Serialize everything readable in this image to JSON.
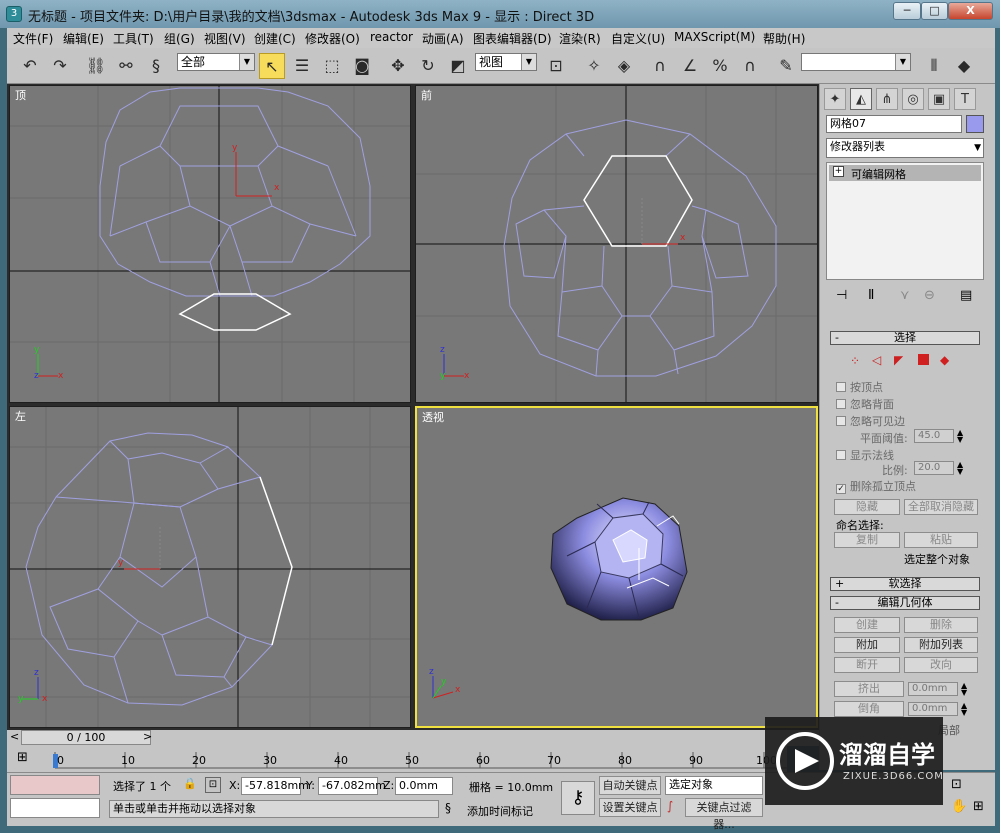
{
  "window": {
    "title": "无标题      - 项目文件夹: D:\\用户目录\\我的文档\\3dsmax      - Autodesk 3ds Max 9      - 显示 : Direct 3D",
    "min_glyph": "─",
    "max_glyph": "□",
    "close_glyph": "X"
  },
  "menu": [
    "文件(F)",
    "编辑(E)",
    "工具(T)",
    "组(G)",
    "视图(V)",
    "创建(C)",
    "修改器(O)",
    "reactor",
    "动画(A)",
    "图表编辑器(D)",
    "渲染(R)",
    "自定义(U)",
    "MAXScript(M)",
    "帮助(H)"
  ],
  "toolbar": {
    "selection_filter": "全部",
    "ref_coord": "视图",
    "named_selection": ""
  },
  "viewports": {
    "top": "顶",
    "front": "前",
    "left": "左",
    "perspective": "透视"
  },
  "command_panel": {
    "object_name": "网格07",
    "object_color": "#9999ee",
    "modifier_list": "修改器列表",
    "stack_item": "可编辑网格",
    "selection_rollout": {
      "title": "选择",
      "by_vertex": "按顶点",
      "ignore_backfacing": "忽略背面",
      "ignore_visible_edges": "忽略可见边",
      "planar_threshold_label": "平面阈值:",
      "planar_threshold": "45.0",
      "show_normals": "显示法线",
      "scale_label": "比例:",
      "scale": "20.0",
      "delete_isolated": "删除孤立顶点",
      "hide": "隐藏",
      "unhide_all": "全部取消隐藏",
      "named_sel": "命名选择:",
      "copy": "复制",
      "paste": "粘贴",
      "select_whole": "选定整个对象"
    },
    "soft_selection": "软选择",
    "edit_geometry": {
      "title": "编辑几何体",
      "create": "创建",
      "delete": "删除",
      "attach": "附加",
      "attach_list": "附加列表",
      "break": "断开",
      "turn": "改向",
      "extrude": "挤出",
      "extrude_val": "0.0mm",
      "chamfer": "倒角",
      "chamfer_val": "0.0mm",
      "partial": "局部"
    }
  },
  "timeline": {
    "frame": "0 / 100",
    "ticks": [
      "0",
      "10",
      "20",
      "30",
      "40",
      "50",
      "60",
      "70",
      "80",
      "90",
      "100"
    ]
  },
  "status": {
    "selected": "选择了 1 个",
    "x_label": "X:",
    "x_value": "-57.818mm",
    "y_label": "Y:",
    "y_value": "-67.082mm",
    "z_label": "Z:",
    "z_value": "0.0mm",
    "grid": "栅格 = 10.0mm",
    "prompt": "单击或单击并拖动以选择对象",
    "add_time_tag": "添加时间标记",
    "auto_key": "自动关键点",
    "set_key": "设置关键点",
    "key_mode": "选定对象",
    "key_filters": "关键点过滤器..."
  },
  "watermark": {
    "brand": "溜溜自学",
    "url": "ZIXUE.3D66.COM"
  }
}
